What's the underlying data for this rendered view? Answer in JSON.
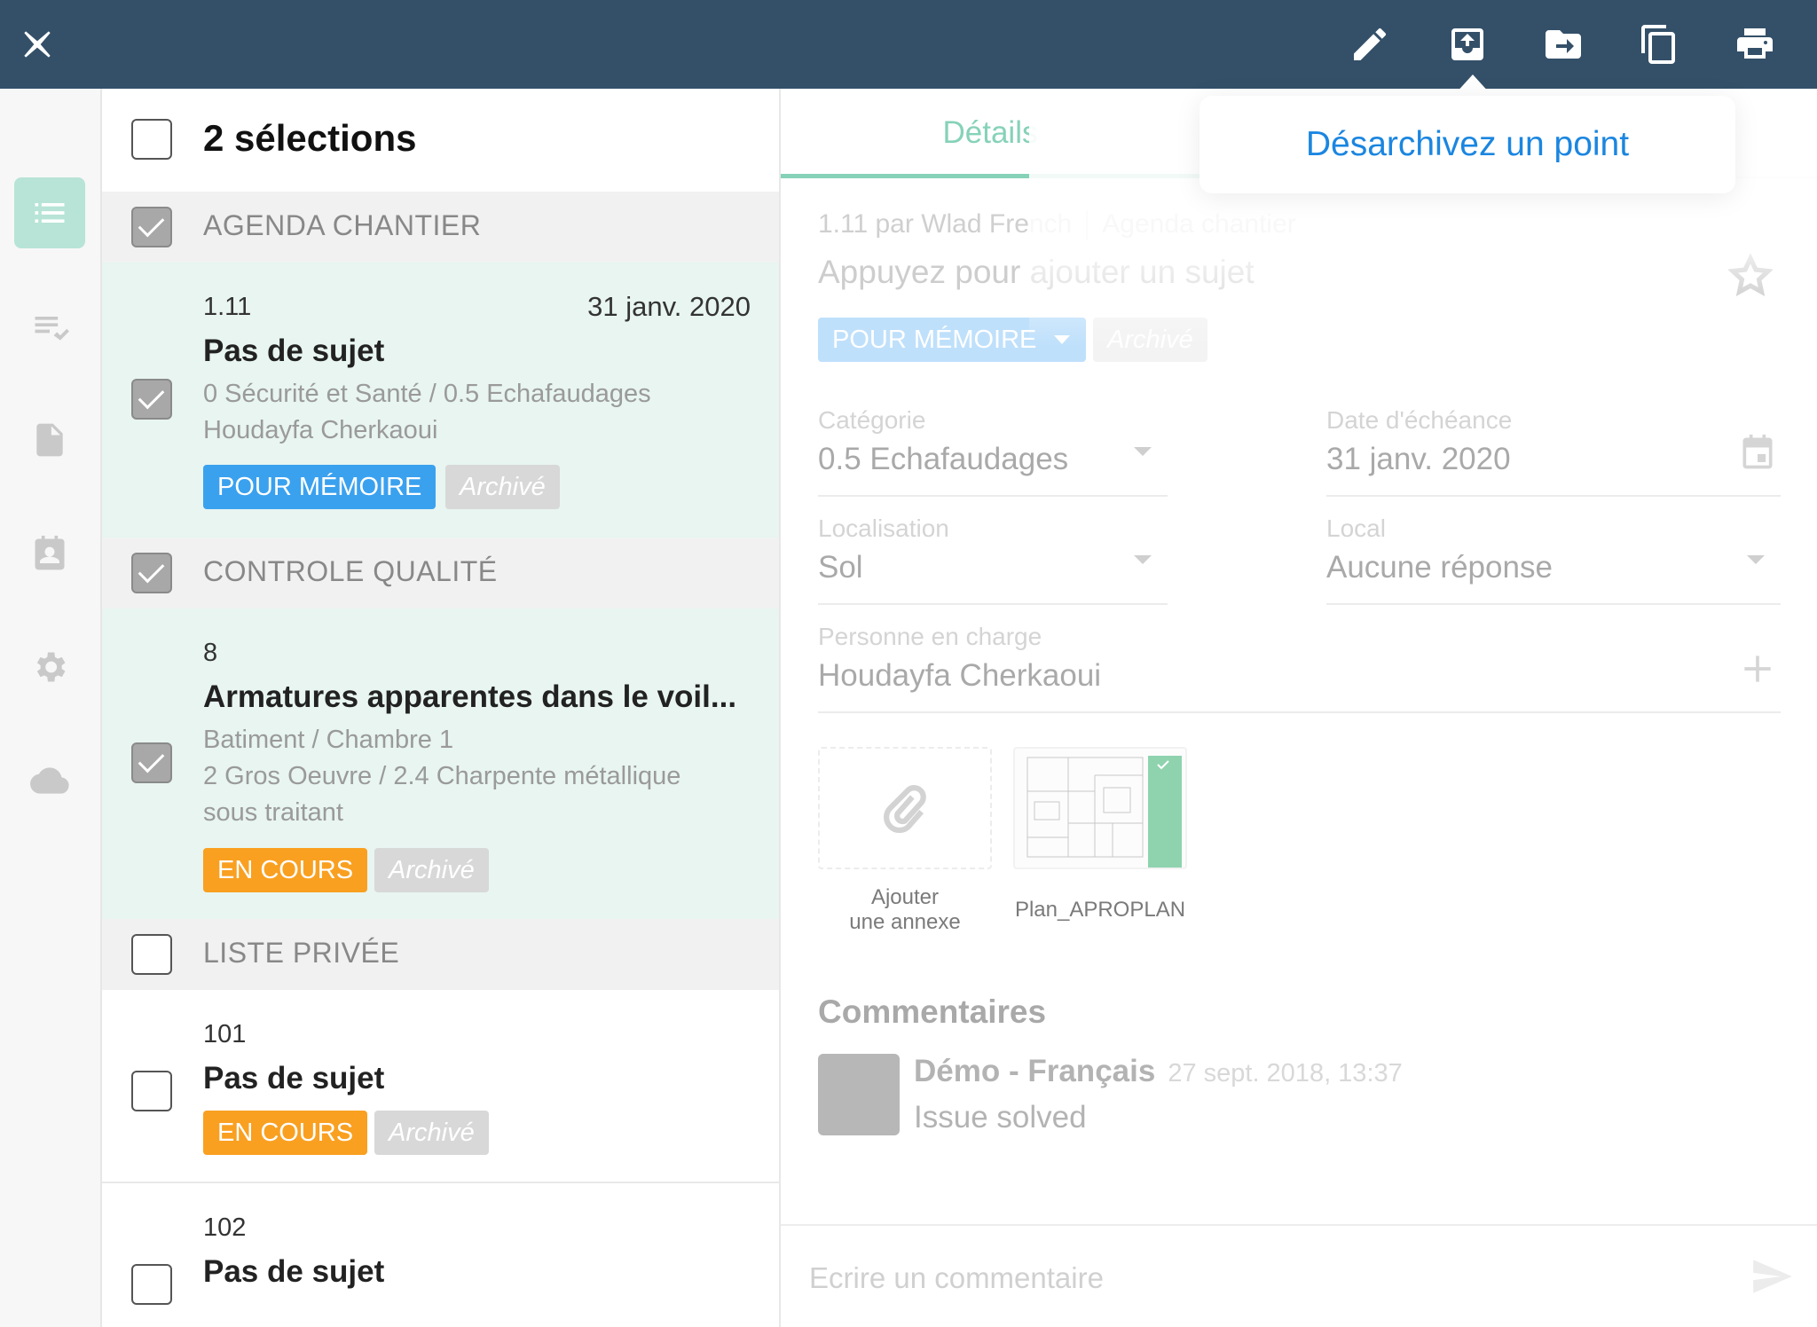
{
  "toolbar": {
    "icons": [
      "close-icon",
      "pencil-icon",
      "unarchive-icon",
      "move-to-folder-icon",
      "duplicate-icon",
      "print-icon"
    ]
  },
  "rail": {
    "items": [
      {
        "icon": "list-icon",
        "active": true
      },
      {
        "icon": "checklist-icon",
        "active": false
      },
      {
        "icon": "document-icon",
        "active": false
      },
      {
        "icon": "contacts-icon",
        "active": false
      },
      {
        "icon": "gear-icon",
        "active": false
      },
      {
        "icon": "cloud-icon",
        "active": false
      }
    ]
  },
  "list": {
    "selection_title": "2 sélections",
    "sections": [
      {
        "title": "AGENDA CHANTIER",
        "checked": true
      },
      {
        "title": "CONTROLE QUALITÉ",
        "checked": true
      },
      {
        "title": "LISTE PRIVÉE",
        "checked": false
      }
    ],
    "items": [
      {
        "number": "1.11",
        "date": "31 janv. 2020",
        "subject": "Pas de sujet",
        "lines": [
          "0 Sécurité et Santé / 0.5 Echafaudages",
          "Houdayfa Cherkaoui"
        ],
        "status": "POUR MÉMOIRE",
        "archived": "Archivé",
        "checked": true
      },
      {
        "number": "8",
        "subject": "Armatures apparentes dans le voil...",
        "lines": [
          "Batiment / Chambre 1",
          "2 Gros Oeuvre / 2.4 Charpente métallique",
          "sous traitant"
        ],
        "status": "EN COURS",
        "archived": "Archivé",
        "checked": true
      },
      {
        "number": "101",
        "subject": "Pas de sujet",
        "status": "EN COURS",
        "archived": "Archivé",
        "checked": false
      },
      {
        "number": "102",
        "subject": "Pas de sujet",
        "checked": false
      }
    ]
  },
  "detail": {
    "tab_label": "Détails",
    "meta_left": "1.11 par Wlad French",
    "meta_right": "Agenda chantier",
    "subject_placeholder": "Appuyez pour ajouter un sujet",
    "status": "POUR MÉMOIRE",
    "archived": "Archivé",
    "fields": {
      "category": {
        "label": "Catégorie",
        "value": "0.5 Echafaudages"
      },
      "due_date": {
        "label": "Date d'échéance",
        "value": "31 janv. 2020"
      },
      "localisation": {
        "label": "Localisation",
        "value": "Sol"
      },
      "local": {
        "label": "Local",
        "value": "Aucune réponse"
      },
      "owner": {
        "label": "Personne en charge",
        "value": "Houdayfa Cherkaoui"
      }
    },
    "attachments": {
      "add_line1": "Ajouter",
      "add_line2": "une annexe",
      "plan_name": "Plan_APROPLAN"
    },
    "comments_title": "Commentaires",
    "comment": {
      "author": "Démo - Français",
      "date": "27 sept. 2018, 13:37",
      "text": "Issue solved"
    },
    "composer_placeholder": "Ecrire un commentaire"
  },
  "tooltip": {
    "text": "Désarchivez un point"
  },
  "colors": {
    "topbar": "#345069",
    "accent_green": "#86d2b9",
    "badge_blue": "#3aa1ef",
    "badge_orange": "#f9a021",
    "tooltip_link": "#1b86e0"
  }
}
